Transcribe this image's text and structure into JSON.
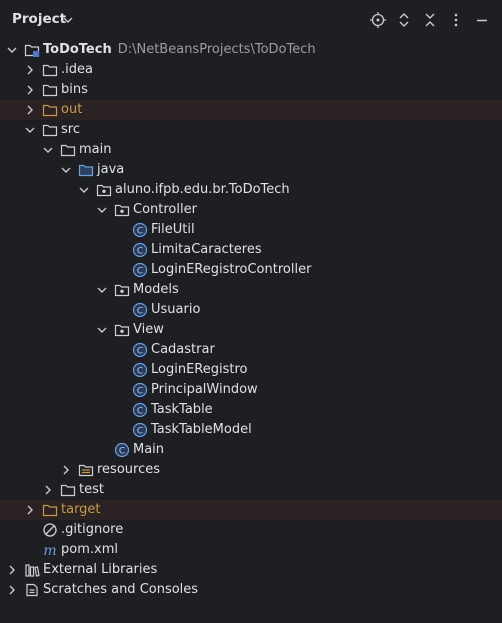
{
  "header": {
    "title": "Project",
    "icons": [
      "crosshair-icon",
      "expand-icon",
      "collapse-icon",
      "more-icon",
      "minimize-icon"
    ]
  },
  "tree": {
    "root": {
      "label": "ToDoTech",
      "path": "D:\\NetBeansProjects\\ToDoTech"
    },
    "idea": ".idea",
    "bins": "bins",
    "out": "out",
    "src": "src",
    "main": "main",
    "java": "java",
    "package": "aluno.ifpb.edu.br.ToDoTech",
    "controller": "Controller",
    "fileutil": "FileUtil",
    "limita": "LimitaCaracteres",
    "loginreg_ctrl": "LoginERegistroController",
    "models": "Models",
    "usuario": "Usuario",
    "view": "View",
    "cadastrar": "Cadastrar",
    "loginreg": "LoginERegistro",
    "principal": "PrincipalWindow",
    "tasktable": "TaskTable",
    "tasktablemodel": "TaskTableModel",
    "main_class": "Main",
    "resources": "resources",
    "test": "test",
    "target": "target",
    "gitignore": ".gitignore",
    "pom": "pom.xml",
    "ext_libs": "External Libraries",
    "scratches": "Scratches and Consoles"
  },
  "colors": {
    "background": "#1e1f22",
    "excluded_row": "#2b2224",
    "folder_blue": "#6f9fd8",
    "class_icon": "#4f79c8",
    "excluded_label": "#c99a4b"
  }
}
